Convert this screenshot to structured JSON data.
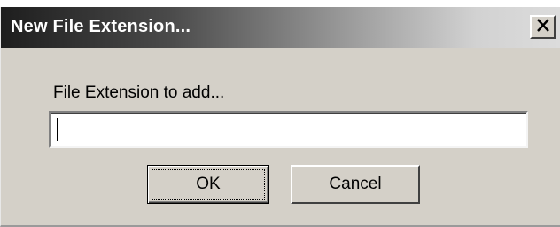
{
  "window": {
    "title": "New File Extension...",
    "close_glyph": "X",
    "close_icon": "close-icon"
  },
  "form": {
    "label": "File Extension to add...",
    "value": "",
    "placeholder": ""
  },
  "buttons": {
    "ok_label": "OK",
    "cancel_label": "Cancel"
  },
  "colors": {
    "dialog_face": "#d4d0c8",
    "title_text": "#ffffff",
    "titlebar_start": "#1e1e1e",
    "titlebar_end": "#dcdcdc"
  }
}
